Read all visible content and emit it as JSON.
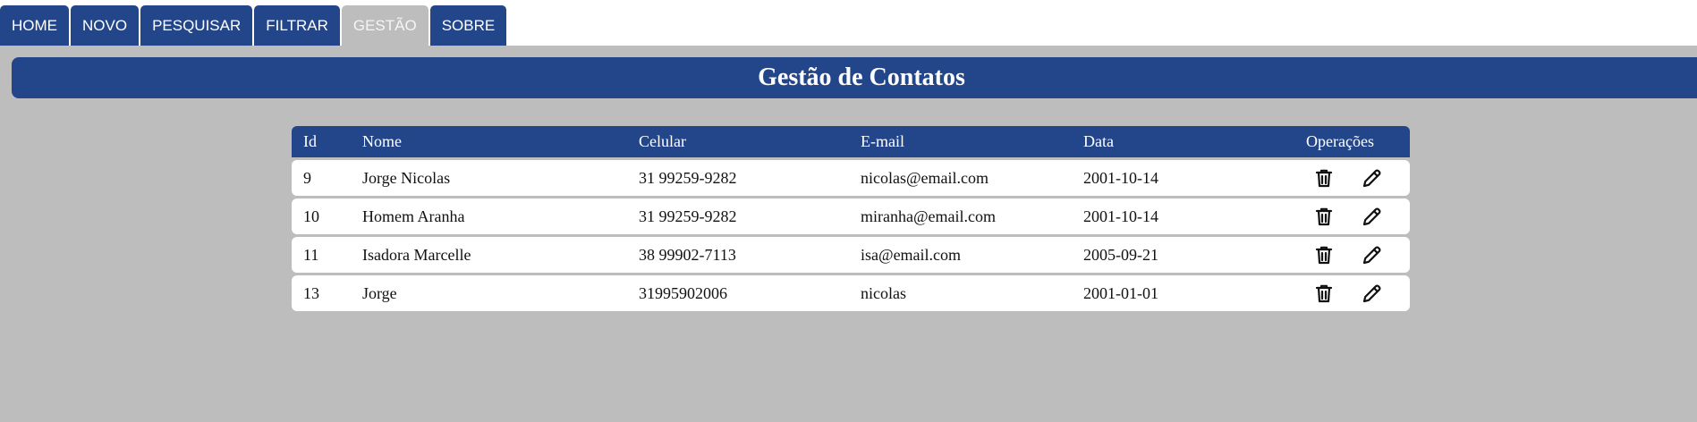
{
  "nav": {
    "tabs": [
      {
        "label": "HOME"
      },
      {
        "label": "NOVO"
      },
      {
        "label": "PESQUISAR"
      },
      {
        "label": "FILTRAR"
      },
      {
        "label": "GESTÃO",
        "active": true
      },
      {
        "label": "SOBRE"
      }
    ]
  },
  "page": {
    "title": "Gestão de Contatos"
  },
  "table": {
    "headers": {
      "id": "Id",
      "nome": "Nome",
      "celular": "Celular",
      "email": "E-mail",
      "data": "Data",
      "operacoes": "Operações"
    },
    "rows": [
      {
        "id": "9",
        "nome": "Jorge Nicolas",
        "celular": "31 99259-9282",
        "email": "nicolas@email.com",
        "data": "2001-10-14"
      },
      {
        "id": "10",
        "nome": "Homem Aranha",
        "celular": "31 99259-9282",
        "email": "miranha@email.com",
        "data": "2001-10-14"
      },
      {
        "id": "11",
        "nome": "Isadora Marcelle",
        "celular": "38 99902-7113",
        "email": "isa@email.com",
        "data": "2005-09-21"
      },
      {
        "id": "13",
        "nome": "Jorge",
        "celular": "31995902006",
        "email": "nicolas",
        "data": "2001-01-01"
      }
    ]
  },
  "icons": {
    "delete": "trash-icon",
    "edit": "pencil-icon"
  },
  "colors": {
    "primary": "#23468b",
    "background": "#bdbdbd",
    "active_tab": "#bdbdbd"
  }
}
